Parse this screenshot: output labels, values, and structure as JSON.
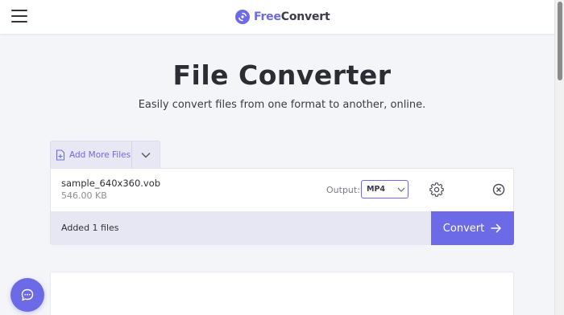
{
  "header": {
    "logo_free": "Free",
    "logo_convert": "Convert",
    "menu_icon": "hamburger-icon"
  },
  "hero": {
    "title": "File Converter",
    "subtitle": "Easily convert files from one format to another, online."
  },
  "toolbar": {
    "add_more_label": "Add More Files"
  },
  "file": {
    "name": "sample_640x360.vob",
    "size": "546.00 KB",
    "output_label": "Output:",
    "output_value": "MP4"
  },
  "footer": {
    "added_text": "Added 1 files",
    "convert_label": "Convert"
  },
  "colors": {
    "accent": "#6c6ae6",
    "background": "#f4f5f9",
    "footer_bg": "#e6e7f2"
  },
  "icons": [
    "hamburger-icon",
    "logo-icon",
    "add-file-icon",
    "chevron-down-icon",
    "gear-icon",
    "close-circle-icon",
    "arrow-right-icon",
    "chat-icon"
  ]
}
